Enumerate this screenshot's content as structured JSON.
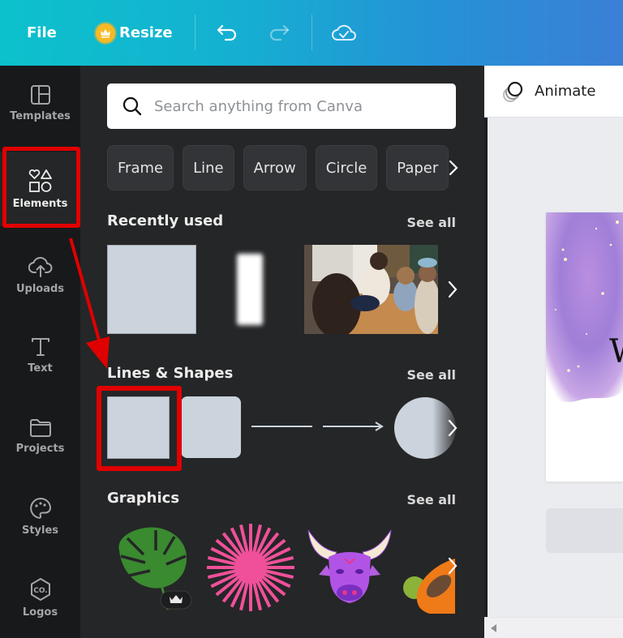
{
  "topbar": {
    "file_label": "File",
    "resize_label": "Resize",
    "icons": [
      "crown-icon",
      "undo-icon",
      "redo-icon",
      "cloud-saved-icon"
    ]
  },
  "rail": {
    "items": [
      {
        "label": "Templates",
        "icon": "templates-icon",
        "active": false
      },
      {
        "label": "Elements",
        "icon": "elements-icon",
        "active": true
      },
      {
        "label": "Uploads",
        "icon": "upload-cloud-icon",
        "active": false
      },
      {
        "label": "Text",
        "icon": "text-icon",
        "active": false
      },
      {
        "label": "Projects",
        "icon": "folder-icon",
        "active": false
      },
      {
        "label": "Styles",
        "icon": "palette-icon",
        "active": false
      },
      {
        "label": "Logos",
        "icon": "logo-hexagon-icon",
        "active": false
      }
    ]
  },
  "panel": {
    "search_placeholder": "Search anything from Canva",
    "chips": [
      "Frame",
      "Line",
      "Arrow",
      "Circle",
      "Paper"
    ],
    "sections": {
      "recent": {
        "title": "Recently used",
        "see_all": "See all",
        "items": [
          "square-shape",
          "blurred-white-bar",
          "family-puzzle-photo"
        ]
      },
      "shapes": {
        "title": "Lines & Shapes",
        "see_all": "See all",
        "items": [
          "square",
          "rounded-square",
          "line",
          "arrow-line",
          "gradient-circle"
        ]
      },
      "graphics": {
        "title": "Graphics",
        "see_all": "See all",
        "items": [
          "monstera-leaf",
          "pink-starburst",
          "purple-bull-head",
          "papaya"
        ]
      }
    }
  },
  "editor": {
    "animate_label": "Animate",
    "page_letter": "W"
  },
  "annotations": {
    "highlight_color": "#e00000"
  },
  "colors": {
    "topbar_start": "#0cc1cc",
    "topbar_end": "#3b7fd6",
    "panel_bg": "#252627",
    "rail_bg": "#18191b",
    "shape_fill": "#cbd4dd"
  }
}
